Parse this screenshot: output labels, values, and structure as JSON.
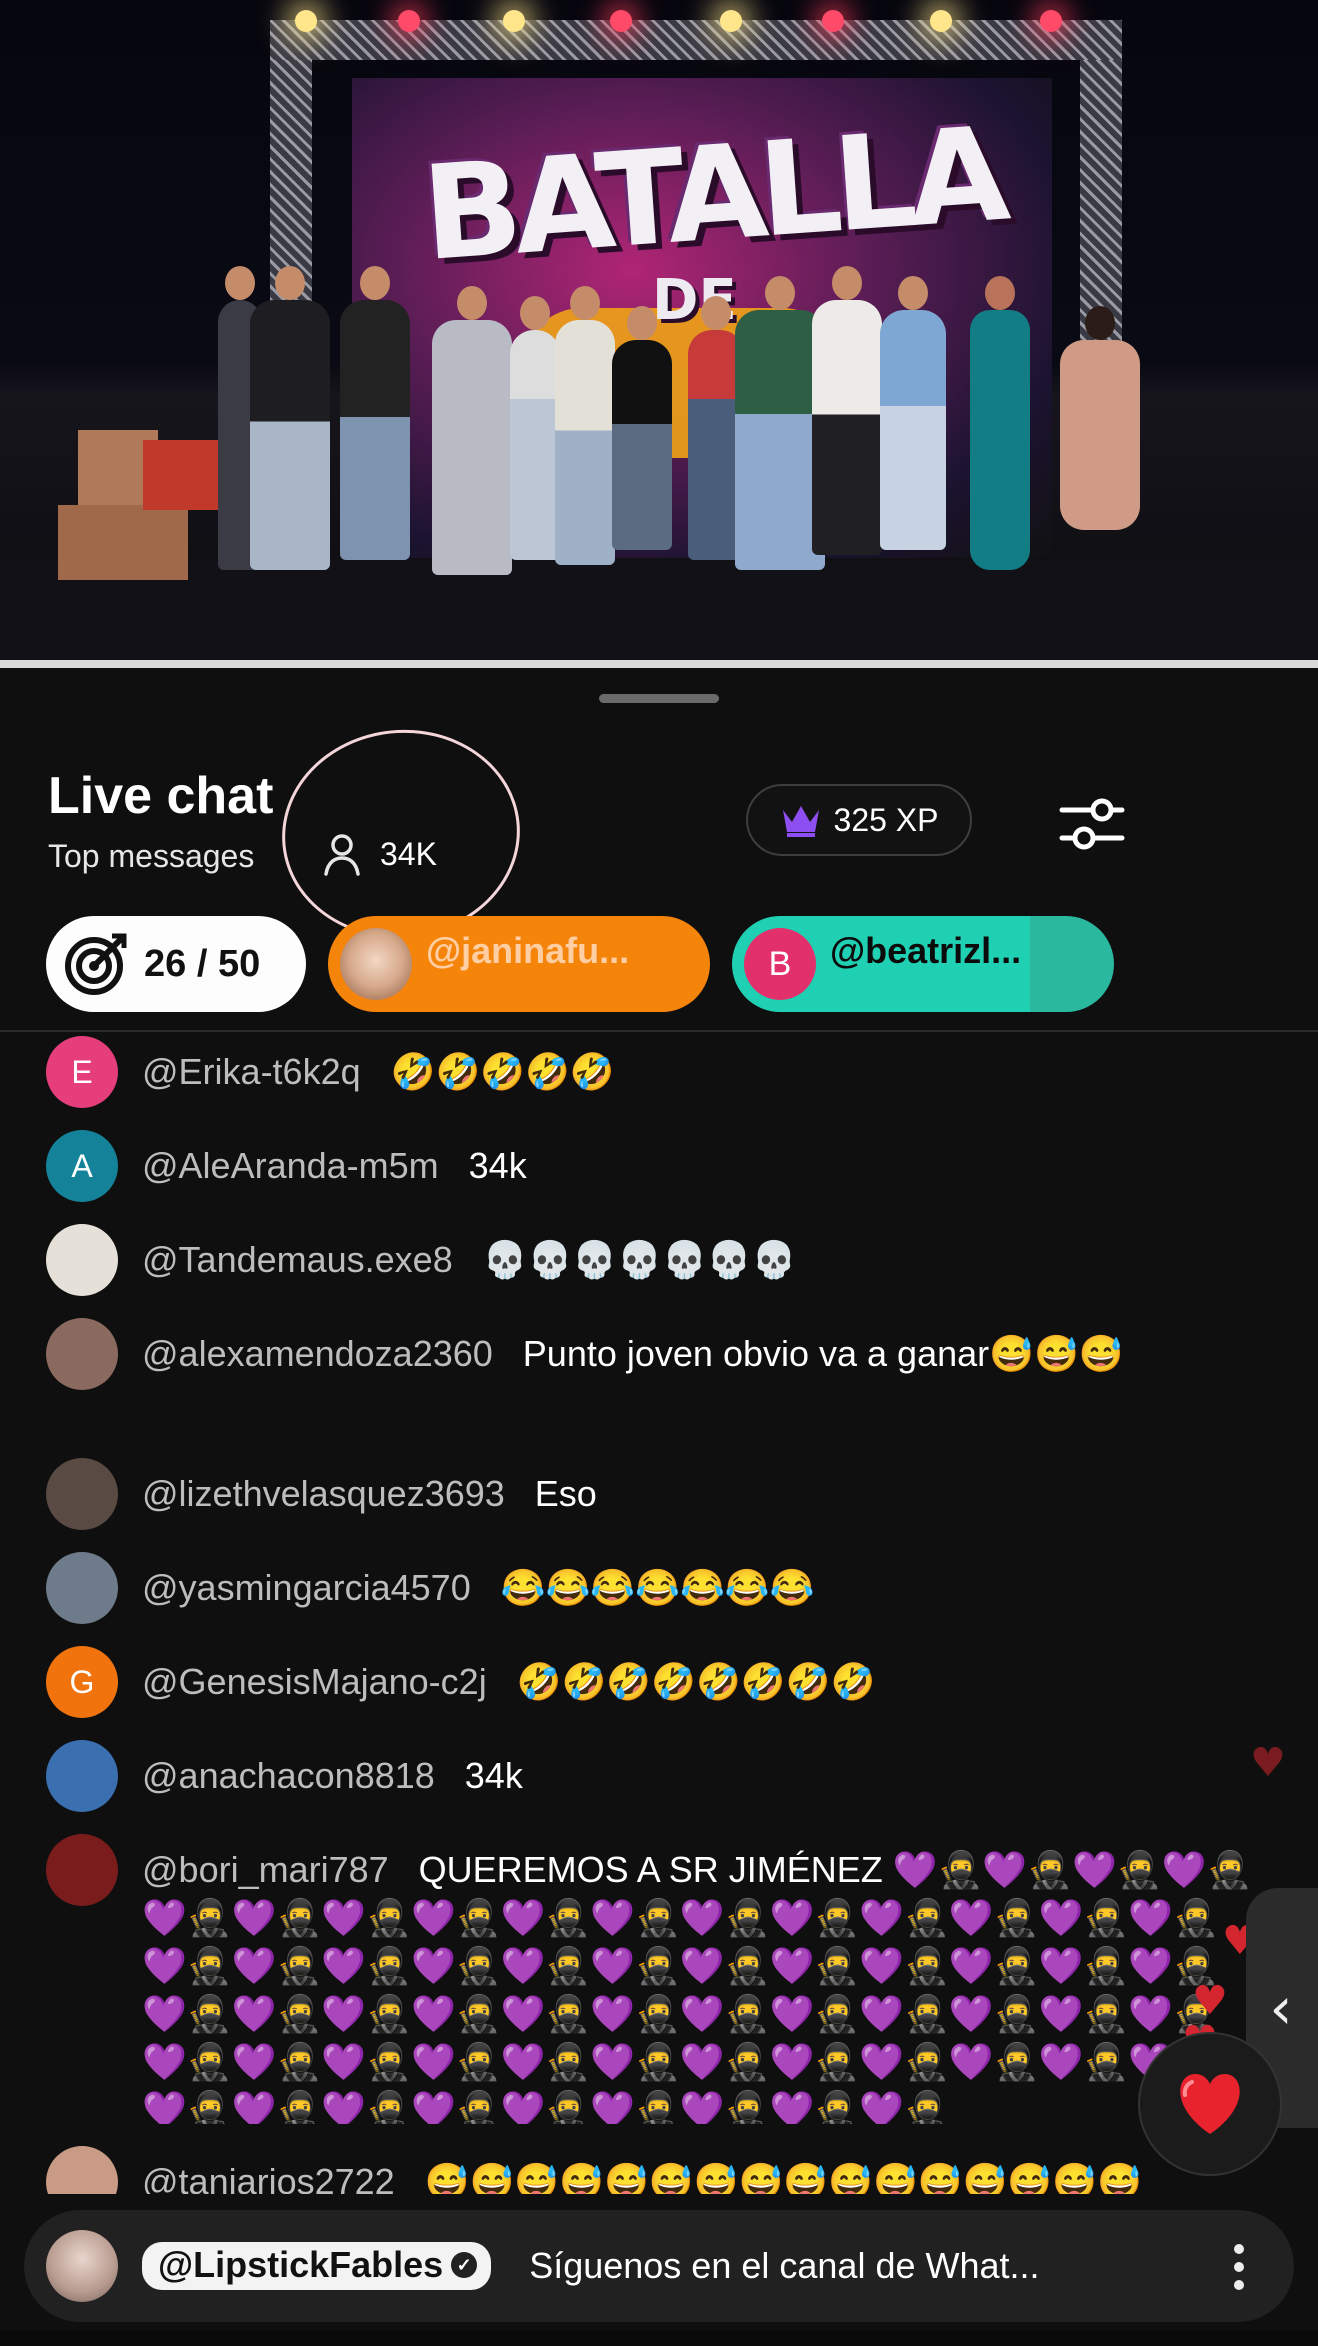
{
  "video": {
    "banner_title": "BATALLA",
    "banner_subtitle": "DE"
  },
  "chat": {
    "title": "Live chat",
    "mode": "Top messages",
    "viewer_count": "34K",
    "xp": "325 XP",
    "icons": {
      "viewer": "person-icon",
      "xp": "crown-icon",
      "settings": "sliders-icon",
      "goal": "target-icon",
      "menu": "more-vert-icon",
      "heart": "heart-icon",
      "expand": "chevron-left-icon"
    }
  },
  "chips": {
    "goal": "26 / 50",
    "users": [
      {
        "name": "@janinafu...",
        "avatar_letter": "",
        "color": "#f5840b"
      },
      {
        "name": "@beatrizl...",
        "avatar_letter": "B",
        "color": "#1fd1b2"
      }
    ]
  },
  "messages": [
    {
      "author": "@Erika-t6k2q",
      "text": "🤣🤣🤣🤣🤣",
      "avatar_letter": "E",
      "avatar_color": "#e53e7a"
    },
    {
      "author": "@AleAranda-m5m",
      "text": "34k",
      "avatar_letter": "A",
      "avatar_color": "#14839a"
    },
    {
      "author": "@Tandemaus.exe8",
      "text": "💀💀💀💀💀💀💀",
      "avatar_letter": "",
      "avatar_color": "#e6e1d8"
    },
    {
      "author": "@alexamendoza2360",
      "text": "Punto joven obvio va a ganar😅😅😅",
      "avatar_letter": "",
      "avatar_color": "#8a6a5e"
    },
    {
      "author": "@lizethvelasquez3693",
      "text": "Eso",
      "avatar_letter": "",
      "avatar_color": "#5a4a44"
    },
    {
      "author": "@yasmingarcia4570",
      "text": "😂😂😂😂😂😂😂",
      "avatar_letter": "",
      "avatar_color": "#6d7b8a"
    },
    {
      "author": "@GenesisMajano-c2j",
      "text": "🤣🤣🤣🤣🤣🤣🤣🤣",
      "avatar_letter": "G",
      "avatar_color": "#f0730e"
    },
    {
      "author": "@anachacon8818",
      "text": "34k",
      "avatar_letter": "",
      "avatar_color": "#3a6fb0"
    },
    {
      "author": "@bori_mari787",
      "text": "QUEREMOS A SR JIMÉNEZ 💜🥷💜🥷💜🥷💜🥷💜🥷💜🥷💜🥷💜🥷💜🥷💜🥷💜🥷💜🥷💜🥷💜🥷💜🥷💜🥷💜🥷💜🥷💜🥷💜🥷💜🥷💜🥷💜🥷💜🥷💜🥷💜🥷💜🥷💜🥷💜🥷💜🥷💜🥷💜🥷💜🥷💜🥷💜🥷💜🥷💜🥷💜🥷💜🥷💜🥷💜🥷💜🥷💜🥷💜🥷💜🥷💜🥷💜🥷💜🥷💜🥷💜🥷💜🥷💜🥷💜🥷💜🥷💜🥷💜🥷💜🥷💜🥷💜🥷💜🥷💜🥷",
      "avatar_letter": "",
      "avatar_color": "#7a1c1c"
    },
    {
      "author": "@taniarios2722",
      "text": "😅😅😅😅😅😅😅😅😅😅😅😅😅😅😅😅",
      "avatar_letter": "",
      "avatar_color": "#c99a86"
    }
  ],
  "pinned": {
    "handle": "@LipstickFables",
    "text": "Síguenos en el canal de What..."
  }
}
